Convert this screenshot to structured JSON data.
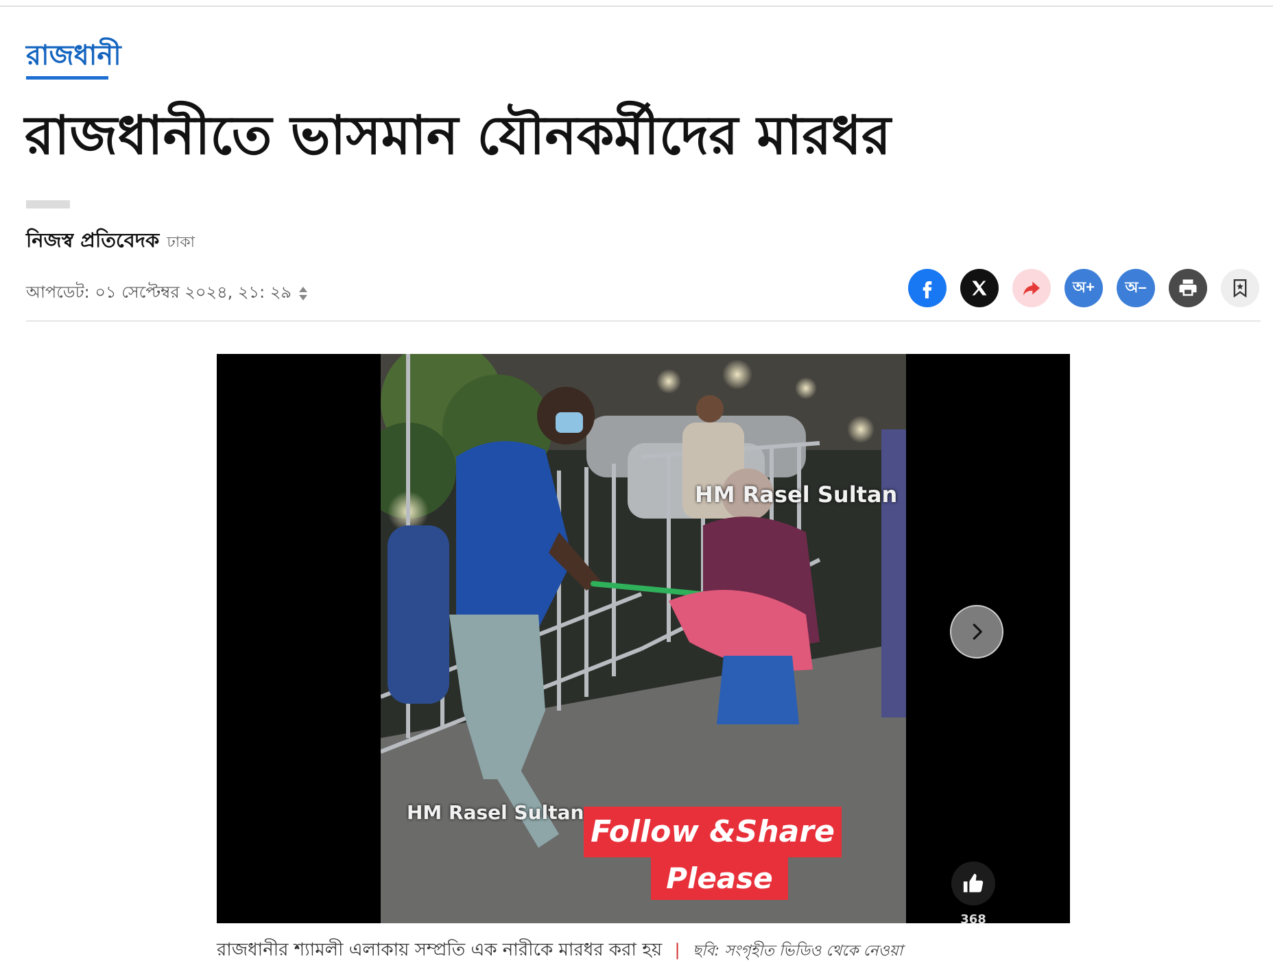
{
  "section": {
    "label": "রাজধানী"
  },
  "article": {
    "headline": "রাজধানীতে ভাসমান যৌনকর্মীদের মারধর",
    "author": "নিজস্ব প্রতিবেদক",
    "location": "ঢাকা",
    "updated": "আপডেট: ০১ সেপ্টেম্বর ২০২৪, ২১: ২৯"
  },
  "share": {
    "increase_font_label": "অ+",
    "decrease_font_label": "অ–"
  },
  "media": {
    "overlay_top": "HM Rasel Sultan",
    "overlay_bottom": "HM Rasel Sultan",
    "banner_line1": "Follow &Share",
    "banner_line2": "Please",
    "like_count": "368"
  },
  "caption": {
    "text": "রাজধানীর শ্যামলী এলাকায় সম্প্রতি এক নারীকে মারধর করা হয়",
    "separator": "|",
    "credit": "ছবি: সংগৃহীত ভিডিও থেকে নেওয়া"
  },
  "colors": {
    "accent": "#1565c0",
    "facebook": "#1877f2",
    "x": "#111111",
    "share_bg": "#fcd9dd",
    "share_arrow": "#e53935",
    "font_btn": "#3d7fd8",
    "print": "#4a4a4a",
    "bookmark_bg": "#eeeeee",
    "banner": "#e8303a"
  }
}
